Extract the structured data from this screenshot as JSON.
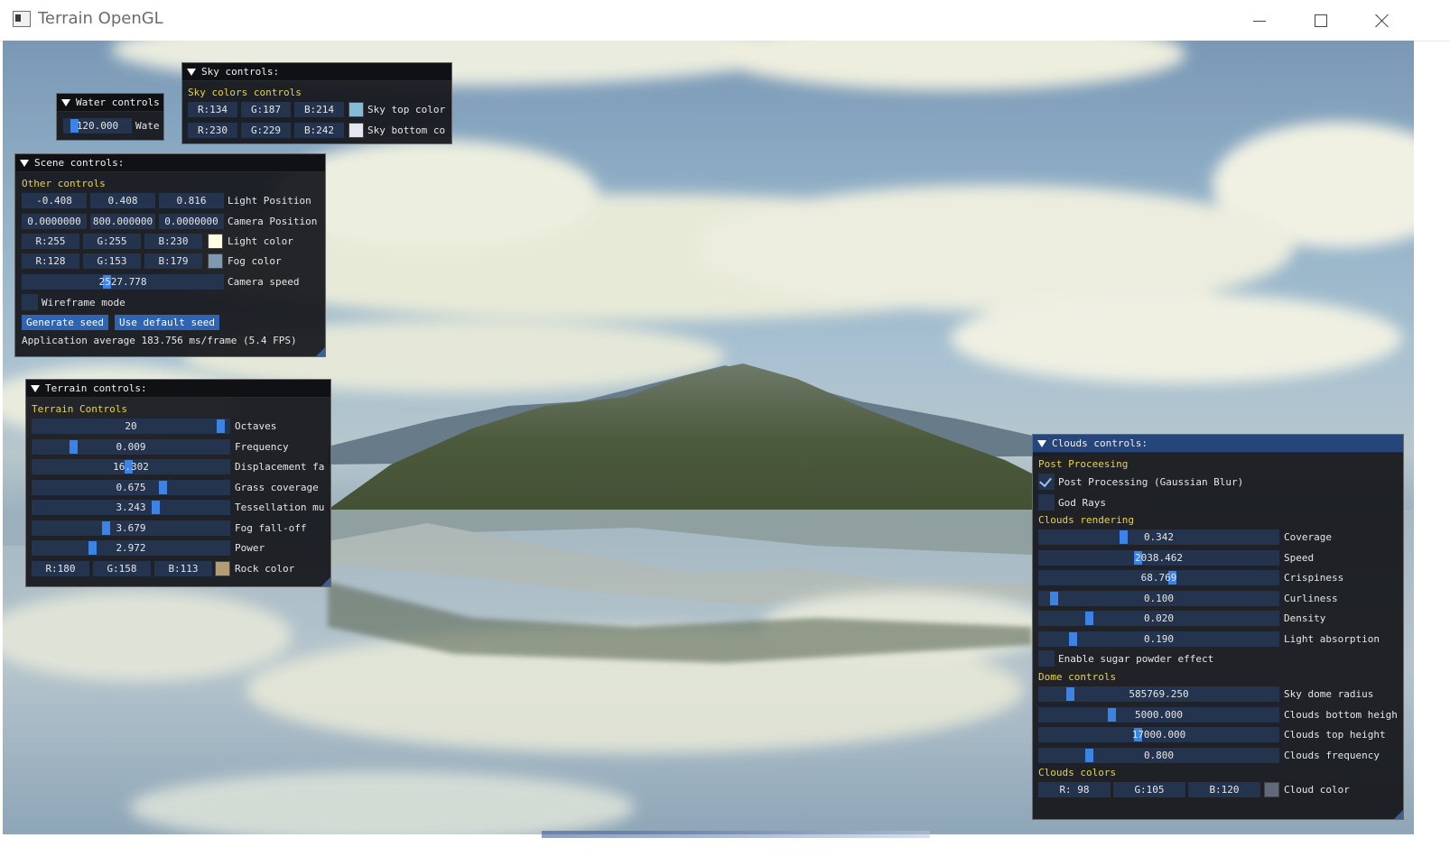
{
  "window": {
    "title": "Terrain OpenGL"
  },
  "water": {
    "header": "Water controls",
    "height": {
      "value": "120.000",
      "fraction": 0.12,
      "label": "Wate"
    }
  },
  "sky": {
    "header": "Sky controls:",
    "section": "Sky colors controls",
    "top": {
      "r": "R:134",
      "g": "G:187",
      "b": "B:214",
      "label": "Sky top color",
      "color": "#86bbd6"
    },
    "bottom": {
      "r": "R:230",
      "g": "G:229",
      "b": "B:242",
      "label": "Sky bottom co",
      "color": "#e6e5f2"
    }
  },
  "scene": {
    "header": "Scene controls:",
    "section": "Other controls",
    "light_pos": {
      "x": "-0.408",
      "y": "0.408",
      "z": "0.816",
      "label": "Light Position"
    },
    "camera_pos": {
      "x": "0.0000000",
      "y": "800.000000",
      "z": "0.0000000",
      "label": "Camera Position"
    },
    "light_color": {
      "r": "R:255",
      "g": "G:255",
      "b": "B:230",
      "label": "Light color",
      "color": "#ffffe6"
    },
    "fog_color": {
      "r": "R:128",
      "g": "G:153",
      "b": "B:179",
      "label": "Fog color",
      "color": "#8099b3"
    },
    "camera_speed": {
      "value": "2527.778",
      "fraction": 0.42,
      "label": "Camera speed"
    },
    "wireframe": {
      "label": "Wireframe mode",
      "checked": false
    },
    "buttons": {
      "generate": "Generate seed",
      "default_seed": "Use default seed"
    },
    "stats": "Application average 183.756 ms/frame (5.4 FPS)"
  },
  "terrain": {
    "header": "Terrain controls:",
    "section": "Terrain Controls",
    "sliders": [
      {
        "value": "20",
        "label": "Octaves",
        "fraction": 0.97
      },
      {
        "value": "0.009",
        "label": "Frequency",
        "fraction": 0.2
      },
      {
        "value": "16.302",
        "label": "Displacement fa",
        "fraction": 0.49
      },
      {
        "value": "0.675",
        "label": "Grass coverage",
        "fraction": 0.67
      },
      {
        "value": "3.243",
        "label": "Tessellation mu",
        "fraction": 0.63
      },
      {
        "value": "3.679",
        "label": "Fog fall-off",
        "fraction": 0.37
      },
      {
        "value": "2.972",
        "label": "Power",
        "fraction": 0.3
      }
    ],
    "rock": {
      "r": "R:180",
      "g": "G:158",
      "b": "B:113",
      "label": "Rock color",
      "color": "#b49e71"
    }
  },
  "clouds": {
    "header": "Clouds controls:",
    "sec_post": "Post Proceesing",
    "post_processing": {
      "label": "Post Processing (Gaussian Blur)",
      "checked": true
    },
    "god_rays": {
      "label": "God Rays",
      "checked": false
    },
    "sec_render": "Clouds rendering",
    "render_sliders": [
      {
        "value": "0.342",
        "label": "Coverage",
        "fraction": 0.35
      },
      {
        "value": "2038.462",
        "label": "Speed",
        "fraction": 0.41
      },
      {
        "value": "68.769",
        "label": "Crispiness",
        "fraction": 0.56
      },
      {
        "value": "0.100",
        "label": "Curliness",
        "fraction": 0.05
      },
      {
        "value": "0.020",
        "label": "Density",
        "fraction": 0.2
      },
      {
        "value": "0.190",
        "label": "Light absorption",
        "fraction": 0.13
      }
    ],
    "sugar": {
      "label": "Enable sugar powder effect",
      "checked": false
    },
    "sec_dome": "Dome controls",
    "dome_sliders": [
      {
        "value": "585769.250",
        "label": "Sky dome radius",
        "fraction": 0.12
      },
      {
        "value": "5000.000",
        "label": "Clouds bottom heigh",
        "fraction": 0.3
      },
      {
        "value": "17000.000",
        "label": "Clouds top height",
        "fraction": 0.41
      },
      {
        "value": "0.800",
        "label": "Clouds frequency",
        "fraction": 0.2
      }
    ],
    "sec_colors": "Clouds colors",
    "cloud_color": {
      "r": "R: 98",
      "g": "G:105",
      "b": "B:120",
      "label": "Cloud color",
      "color": "#626978"
    }
  }
}
